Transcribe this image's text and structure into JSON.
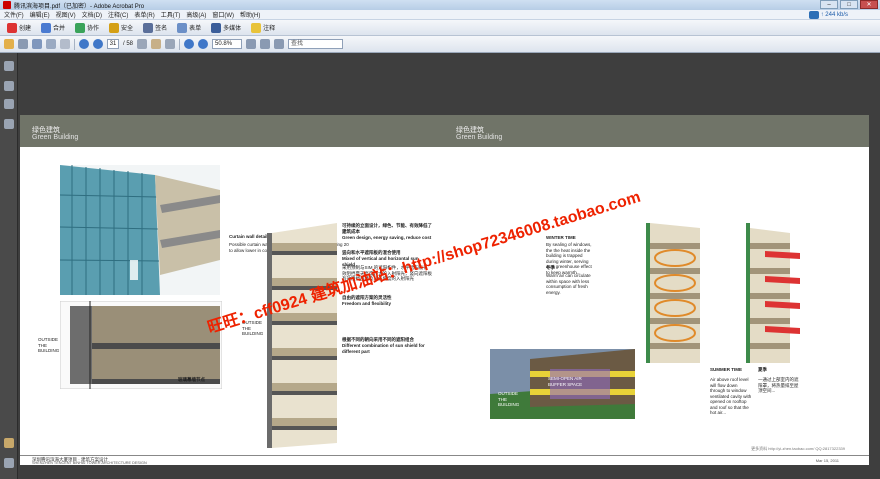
{
  "window": {
    "title": "腾讯滨海项目.pdf（已加密）- Adobe Acrobat Pro"
  },
  "menu": [
    "文件(F)",
    "编辑(E)",
    "视图(V)",
    "文档(D)",
    "注释(C)",
    "表单(R)",
    "工具(T)",
    "高级(A)",
    "窗口(W)",
    "帮助(H)"
  ],
  "speed": {
    "label": "↑ 244 kb/s"
  },
  "toolbar1": {
    "create": "创建",
    "combine": "合并",
    "collaborate": "协作",
    "secure": "安全",
    "sign": "签名",
    "forms": "表单",
    "multimedia": "多媒体",
    "comment": "注释"
  },
  "toolbar2": {
    "page_current": "31",
    "page_total": "/ 58",
    "zoom": "50.8%",
    "search_placeholder": "查找"
  },
  "page": {
    "left_header_cn": "绿色建筑",
    "left_header_en": "Green  Building",
    "right_header_cn": "绿色建筑",
    "right_header_en": "Green  Building",
    "curtain_title": "Curtain wall detail",
    "curtain_sub": "Possible curtain wall facade (solar read-heat) for shading 20 to allow lower in comfort space",
    "p1_cn": "可持续的立面设计，绿色、节能、有效降低了建筑成本",
    "p1_en": "Green design, energy saving, reduce cost",
    "p2_title_cn": "竖向和水平遮阳板的混合使用",
    "p2_title_en": "Mixed of vertical and horizontal sun shield",
    "p3_cn": "采用预制与SIM 的遮阳构件，水平遮阳板有效阻挡夏天高度较大的入射阳光，竖向遮阳板有效阻挡西晒及较低角度的入射阳光",
    "p4_title_cn": "自由的遮阳方案的灵活性",
    "p4_title_en": "Freedom and flexibility",
    "p5_cn": "根据不同的朝向采用不同的遮阳组合",
    "p5_en": "Different combination of sun shield for different part",
    "glass_label_cn": "玻璃幕墙节点",
    "outside_label": "OUTSIDE THE BUILDING",
    "inside_label": "INSIDE THE BUILDING",
    "winter_title": "WINTER TIME",
    "winter_text": "By sealing of windows, the the heat inside the building is trapped during winter, serving as a greenhouse effect to keep warmth...",
    "winter_cn": "冬季",
    "winter_note": "Warm air can circulate within space with less consumption of fresh energy.",
    "summer_title": "SUMMER TIME",
    "summer_cn": "夏季",
    "summer_text": "Air above roof level will flow down through to window ventilated cavity with opened on rooftop and roof so that the hot air...",
    "summer_cn_text": "一通过上部室内的遮阳罩，将热量排至屋顶空间...",
    "semi_label": "SEMI-OPEN AIR BUFFER SPACE",
    "footer_cn": "深圳腾讯滨海大厦项目 · 建筑方案设计",
    "footer_en": "SHENZHEN TENCENT BINHAI TOWER ARCHITECTURE DESIGN",
    "footer_date": "Mar 15, 2011",
    "corner_logo": "更多资料 http://yi-zhen.taobao.com/  QQ:2817322339"
  },
  "watermark": {
    "line1": "旺旺：cff0924  建筑加油站：http://shop72346008.taobao.com"
  }
}
